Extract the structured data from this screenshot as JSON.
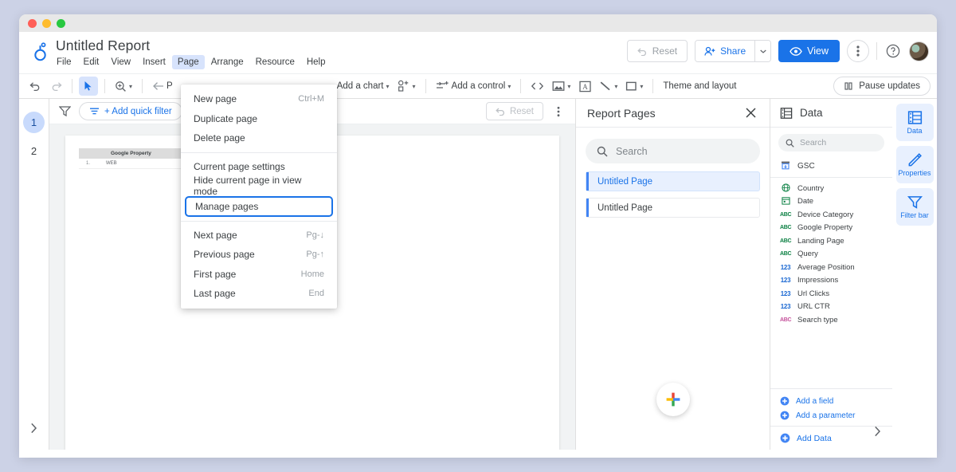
{
  "app": {
    "logo_icon": "looker-studio-logo",
    "report_title": "Untitled Report",
    "menubar": [
      "File",
      "Edit",
      "View",
      "Insert",
      "Page",
      "Arrange",
      "Resource",
      "Help"
    ],
    "active_menu": "Page"
  },
  "header_actions": {
    "reset_label": "Reset",
    "reset_icon": "undo-icon",
    "share_label": "Share",
    "share_icon": "person-add-icon",
    "share_caret_icon": "chevron-down-icon",
    "view_label": "View",
    "view_icon": "eye-icon",
    "more_icon": "more-vert-icon",
    "help_icon": "help-circle-icon",
    "avatar_icon": "user-avatar"
  },
  "toolbar": {
    "undo_icon": "undo-icon",
    "redo_icon": "redo-icon",
    "select_icon": "cursor-arrow-icon",
    "zoom_icon": "magnifier-plus-icon",
    "back_icon": "arrow-left-icon",
    "back_label": "P",
    "add_chart_label": "Add a chart",
    "community_viz_icon": "community-visualization-icon",
    "add_control_icon": "control-sliders-icon",
    "add_control_label": "Add a control",
    "embed_code_icon": "embed-code-icon",
    "image_icon": "image-icon",
    "text_box_icon": "text-box-icon",
    "line_icon": "line-icon",
    "rectangle_icon": "rectangle-icon",
    "theme_layout_label": "Theme and layout",
    "pause_updates_label": "Pause updates",
    "pause_icon": "pause-icon"
  },
  "page_menu": {
    "items": [
      {
        "label": "New page",
        "shortcut": "Ctrl+M",
        "highlighted": false
      },
      {
        "label": "Duplicate page",
        "shortcut": "",
        "highlighted": false
      },
      {
        "label": "Delete page",
        "shortcut": "",
        "highlighted": false
      },
      {
        "separator": true
      },
      {
        "label": "Current page settings",
        "shortcut": "",
        "highlighted": false
      },
      {
        "label": "Hide current page in view mode",
        "shortcut": "",
        "highlighted": false
      },
      {
        "label": "Manage pages",
        "shortcut": "",
        "highlighted": true
      },
      {
        "separator": true
      },
      {
        "label": "Next page",
        "shortcut": "Pg-↓",
        "highlighted": false
      },
      {
        "label": "Previous page",
        "shortcut": "Pg-↑",
        "highlighted": false
      },
      {
        "label": "First page",
        "shortcut": "Home",
        "highlighted": false
      },
      {
        "label": "Last page",
        "shortcut": "End",
        "highlighted": false
      }
    ],
    "highlight_color": "#1a73e8"
  },
  "page_rail": {
    "pages": [
      {
        "number": "1",
        "selected": true
      },
      {
        "number": "2",
        "selected": false
      }
    ],
    "expand_icon": "chevron-right-icon"
  },
  "canvas": {
    "filter_icon": "filter-icon",
    "add_quick_filter_label": "+ Add quick filter",
    "quick_filter_icon": "filter-lines-icon",
    "reset_label": "Reset",
    "reset_icon": "undo-icon",
    "kebab_icon": "more-vert-icon",
    "table": {
      "header": "Google Property",
      "rows": [
        {
          "index": "1.",
          "value": "WEB"
        }
      ]
    }
  },
  "report_pages": {
    "title": "Report Pages",
    "close_icon": "close-icon",
    "search_icon": "search-icon",
    "search_placeholder": "Search",
    "pages": [
      {
        "label": "Untitled Page",
        "selected": true
      },
      {
        "label": "Untitled Page",
        "selected": false
      }
    ],
    "add_page_icon": "google-plus-icon"
  },
  "data_panel": {
    "title": "Data",
    "title_icon": "data-table-icon",
    "search_icon": "search-icon",
    "search_placeholder": "Search",
    "source": {
      "name": "GSC",
      "icon": "data-source-icon"
    },
    "fields": [
      {
        "label": "Country",
        "icon": "globe-icon",
        "type": "geo"
      },
      {
        "label": "Date",
        "icon": "calendar-icon",
        "type": "date"
      },
      {
        "label": "Device Category",
        "icon": "ABC",
        "type": "dimension"
      },
      {
        "label": "Google Property",
        "icon": "ABC",
        "type": "dimension"
      },
      {
        "label": "Landing Page",
        "icon": "ABC",
        "type": "dimension"
      },
      {
        "label": "Query",
        "icon": "ABC",
        "type": "dimension"
      },
      {
        "label": "Average Position",
        "icon": "123",
        "type": "metric"
      },
      {
        "label": "Impressions",
        "icon": "123",
        "type": "metric"
      },
      {
        "label": "Url Clicks",
        "icon": "123",
        "type": "metric"
      },
      {
        "label": "URL CTR",
        "icon": "123",
        "type": "metric"
      },
      {
        "label": "Search type",
        "icon": "ABC",
        "type": "parameter"
      }
    ],
    "actions": [
      {
        "label": "Add a field",
        "icon": "plus-circle-icon"
      },
      {
        "label": "Add a parameter",
        "icon": "plus-circle-icon"
      }
    ],
    "add_data": {
      "label": "Add Data",
      "icon": "plus-circle-icon"
    },
    "expand_icon": "chevron-right-icon"
  },
  "right_rail": {
    "buttons": [
      {
        "label": "Data",
        "icon": "data-table-icon"
      },
      {
        "label": "Properties",
        "icon": "pencil-icon"
      },
      {
        "label": "Filter bar",
        "icon": "filter-icon"
      }
    ]
  },
  "colors": {
    "accent": "#1a73e8",
    "accent_light": "#e8f0fe",
    "desktop": "#ccd2e6"
  }
}
